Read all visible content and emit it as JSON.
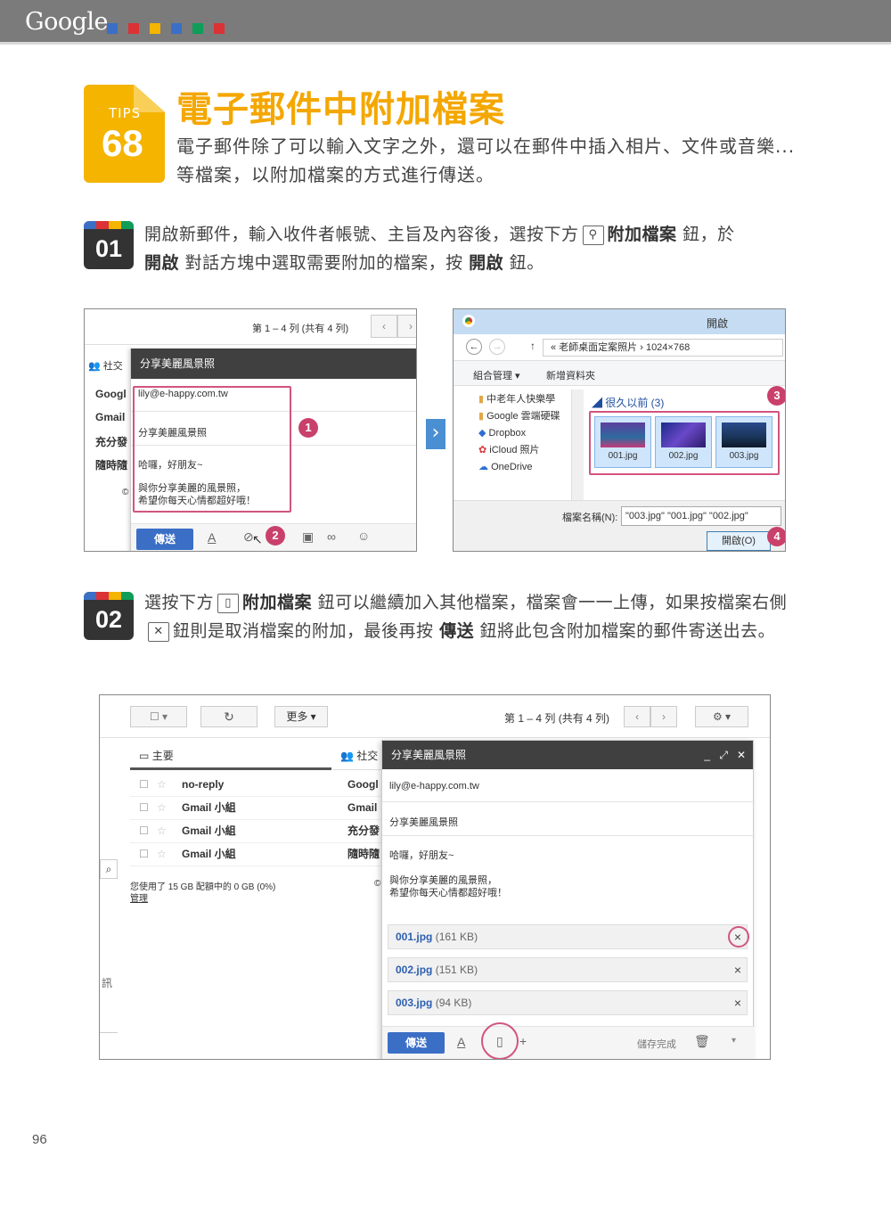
{
  "header": {
    "brand": "Google",
    "squares": [
      "#3b6fc6",
      "#db3236",
      "#f4b400",
      "#3b6fc6",
      "#0f9d58",
      "#db3236"
    ]
  },
  "tips": {
    "word": "TIPS",
    "number": "68",
    "title": "電子郵件中附加檔案",
    "intro": "電子郵件除了可以輸入文字之外，還可以在郵件中插入相片、文件或音樂...等檔案，以附加檔案的方式進行傳送。"
  },
  "step1": {
    "num": "01",
    "t1": "開啟新郵件，輸入收件者帳號、主旨及內容後，選按下方",
    "b1": "附加檔案",
    "t2": "鈕，於",
    "b2": "開啟",
    "t3": "對話方塊中選取需要附加的檔案，按",
    "b3": "開啟",
    "t4": "鈕。"
  },
  "step2": {
    "num": "02",
    "t1": "選按下方",
    "b1": "附加檔案",
    "t2": "鈕可以繼續加入其他檔案，檔案會一一上傳，如果按檔案右側",
    "t3": "鈕則是取消檔案的附加，最後再按",
    "b2": "傳送",
    "t4": "鈕將此包含附加檔案的郵件寄送出去。"
  },
  "shot1": {
    "paging": "第 1 – 4 列 (共有 4 列)",
    "social": "社交",
    "senders": [
      "Googl",
      "Gmail",
      "充分發",
      "隨時隨"
    ],
    "compose_title": "分享美麗風景照",
    "to": "lily@e-happy.com.tw",
    "subject": "分享美麗風景照",
    "body1": "哈囉，好朋友~",
    "body2": "與你分享美麗的風景照，",
    "body3": "希望你每天心情都超好哦！",
    "send": "傳送",
    "c": "©"
  },
  "shot2": {
    "title": "開啟",
    "path": "« 老師桌面定案照片 › 1024×768",
    "organize": "組合管理 ▾",
    "newfolder": "新增資料夾",
    "tree": [
      "中老年人快樂學",
      "Google 雲端硬碟",
      "Dropbox",
      "iCloud 照片",
      "OneDrive"
    ],
    "group": "很久以前 (3)",
    "files": [
      "001.jpg",
      "002.jpg",
      "003.jpg"
    ],
    "filename_label": "檔案名稱(N):",
    "filename_value": "\"003.jpg\" \"001.jpg\" \"002.jpg\"",
    "open": "開啟(O)"
  },
  "shot3": {
    "more": "更多",
    "paging": "第 1 – 4 列 (共有 4 列)",
    "primary": "主要",
    "social": "社交",
    "rows": [
      {
        "sender": "no-reply",
        "preview": "Googl"
      },
      {
        "sender": "Gmail 小組",
        "preview": "Gmail"
      },
      {
        "sender": "Gmail 小組",
        "preview": "充分發"
      },
      {
        "sender": "Gmail 小組",
        "preview": "隨時隨"
      }
    ],
    "storage": "您使用了 15 GB 配額中的 0 GB (0%)",
    "manage": "管理",
    "side": "訊",
    "c": "©",
    "compose_title": "分享美麗風景照",
    "to": "lily@e-happy.com.tw",
    "subject": "分享美麗風景照",
    "body1": "哈囉，好朋友~",
    "body2": "與你分享美麗的風景照，",
    "body3": "希望你每天心情都超好哦！",
    "attachments": [
      {
        "name": "001.jpg",
        "size": "(161 KB)"
      },
      {
        "name": "002.jpg",
        "size": "(151 KB)"
      },
      {
        "name": "003.jpg",
        "size": "(94 KB)"
      }
    ],
    "send": "傳送",
    "saved": "儲存完成"
  },
  "callouts": [
    "1",
    "2",
    "3",
    "4"
  ],
  "page_number": "96"
}
